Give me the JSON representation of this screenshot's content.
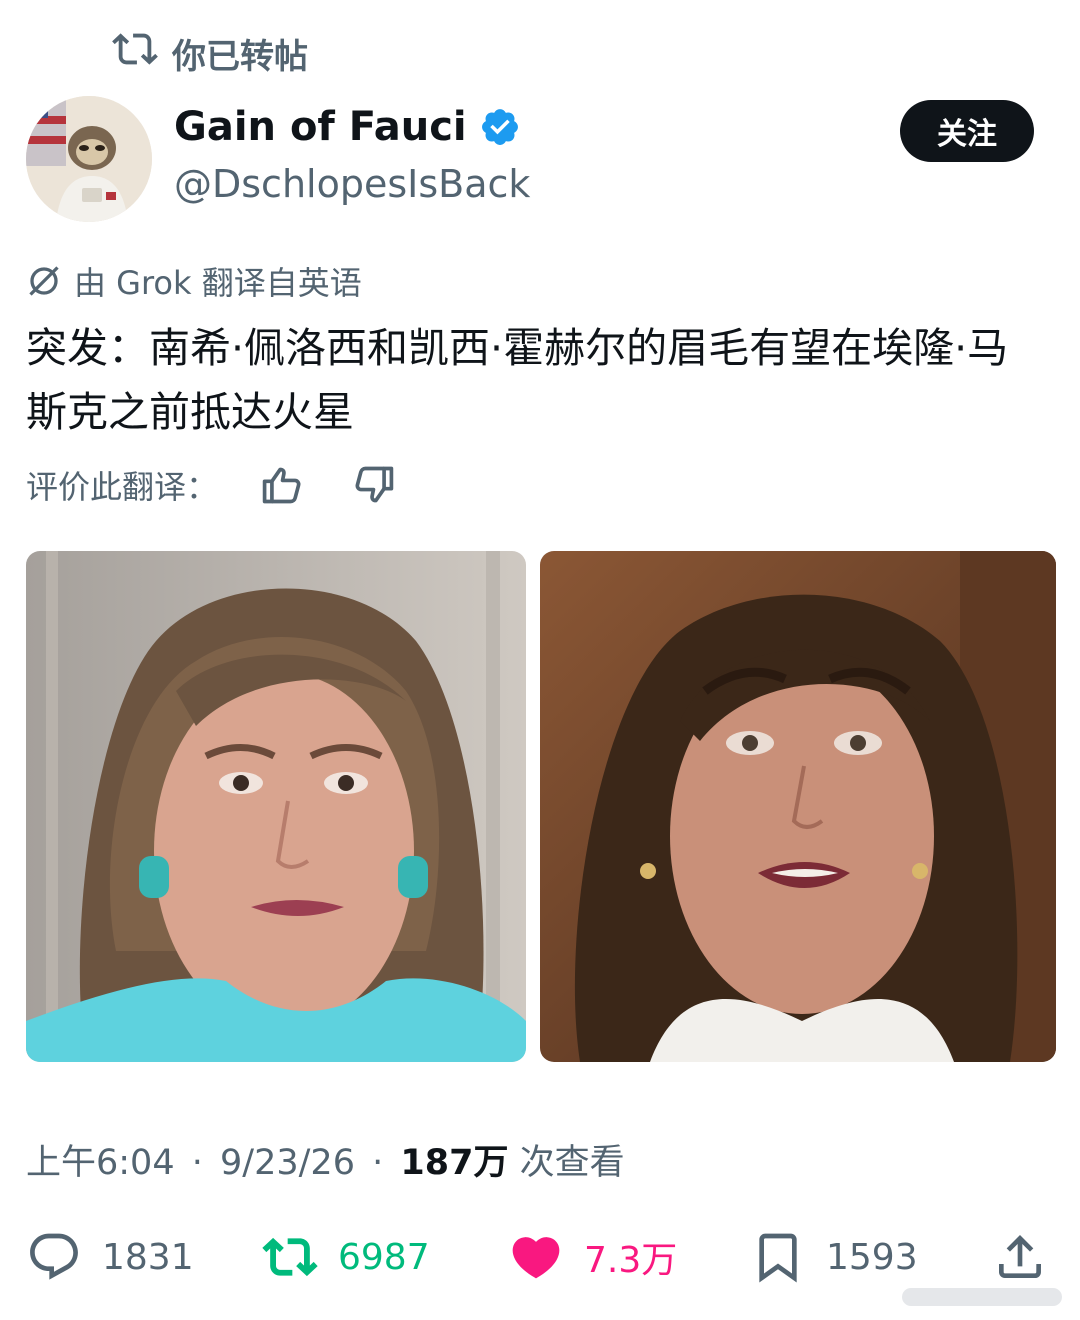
{
  "repost": {
    "label": "你已转帖",
    "icon": "repost-icon"
  },
  "author": {
    "display_name": "Gain of Fauci",
    "handle": "@DschlopesIsBack",
    "verified": true
  },
  "follow_button": {
    "label": "关注"
  },
  "translation": {
    "note": "由 Grok 翻译自英语"
  },
  "tweet": {
    "text": "突发：南希·佩洛西和凯西·霍赫尔的眉毛有望在埃隆·马斯克之前抵达火星"
  },
  "rate": {
    "label": "评价此翻译："
  },
  "meta": {
    "time": "上午6:04",
    "date": "9/23/26",
    "separator": "·",
    "views": "187万",
    "views_label": " 次查看"
  },
  "actions": {
    "replies": "1831",
    "reposts": "6987",
    "likes": "7.3万",
    "bookmarks": "1593"
  },
  "colors": {
    "repost_active": "#00ba7c",
    "like_active": "#f91880",
    "verified": "#1d9bf0",
    "secondary_text": "#536471",
    "primary_text": "#0f1419"
  }
}
